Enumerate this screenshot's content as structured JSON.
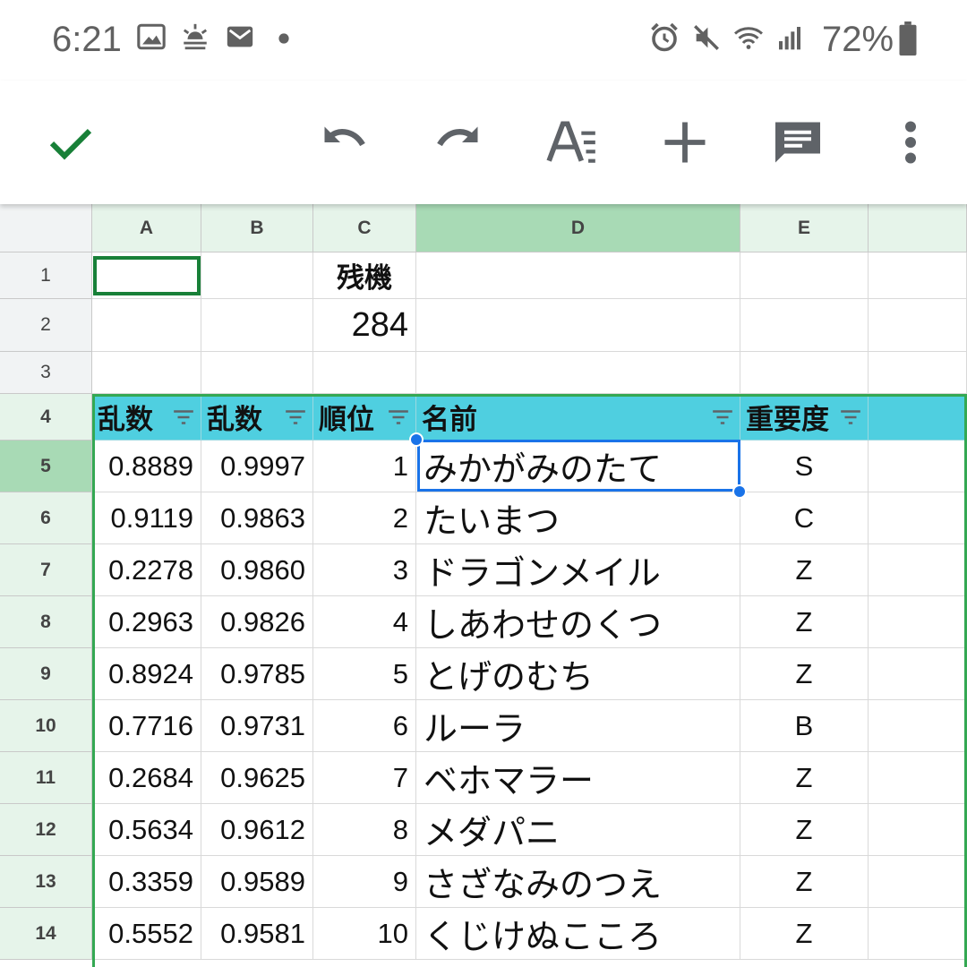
{
  "status_bar": {
    "time": "6:21",
    "battery": "72%",
    "icons": [
      "image-icon",
      "weather-icon",
      "mail-icon",
      "dot-icon",
      "alarm-icon",
      "mute-icon",
      "wifi-icon",
      "signal-icon",
      "battery-icon"
    ]
  },
  "toolbar": {
    "icons": [
      "check-icon",
      "undo-icon",
      "redo-icon",
      "text-format-icon",
      "add-icon",
      "comment-icon",
      "more-vert-icon"
    ],
    "accent_color": "#188038"
  },
  "sheet": {
    "columns": [
      "A",
      "B",
      "C",
      "D",
      "E"
    ],
    "rows": [
      "1",
      "2",
      "3",
      "4",
      "5",
      "6",
      "7",
      "8",
      "9",
      "10",
      "11",
      "12",
      "13",
      "14"
    ],
    "c1": "残機",
    "c2": "284",
    "headers": [
      "乱数",
      "乱数",
      "順位",
      "名前",
      "重要度"
    ],
    "data": [
      [
        "0.8889",
        "0.9997",
        "1",
        "みかがみのたて",
        "S"
      ],
      [
        "0.9119",
        "0.9863",
        "2",
        "たいまつ",
        "C"
      ],
      [
        "0.2278",
        "0.9860",
        "3",
        "ドラゴンメイル",
        "Z"
      ],
      [
        "0.2963",
        "0.9826",
        "4",
        "しあわせのくつ",
        "Z"
      ],
      [
        "0.8924",
        "0.9785",
        "5",
        "とげのむち",
        "Z"
      ],
      [
        "0.7716",
        "0.9731",
        "6",
        "ルーラ",
        "B"
      ],
      [
        "0.2684",
        "0.9625",
        "7",
        "ベホマラー",
        "Z"
      ],
      [
        "0.5634",
        "0.9612",
        "8",
        "メダパニ",
        "Z"
      ],
      [
        "0.3359",
        "0.9589",
        "9",
        "さざなみのつえ",
        "Z"
      ],
      [
        "0.5552",
        "0.9581",
        "10",
        "くじけぬこころ",
        "Z"
      ]
    ],
    "header_color": "#4fcfe0",
    "selection_color": "#1a73e8"
  }
}
